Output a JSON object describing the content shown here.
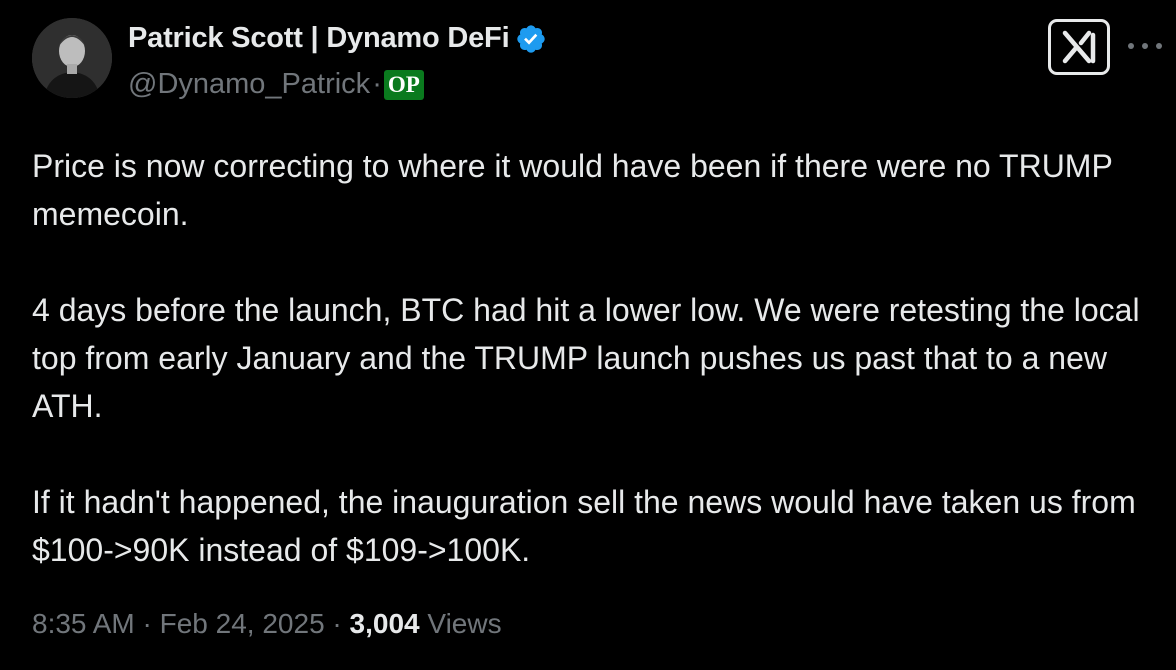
{
  "author": {
    "display_name": "Patrick Scott | Dynamo DeFi",
    "handle": "@Dynamo_Patrick",
    "separator": "·",
    "op_badge": "OP",
    "verified_color": "#1d9bf0",
    "icons": [
      "avatar",
      "verified-badge-icon",
      "grok-icon",
      "more-icon"
    ]
  },
  "tweet": {
    "paragraphs": [
      "Price is now correcting to where it would have been if there were no TRUMP memecoin.",
      "4 days before the launch, BTC had hit a lower low. We were retesting the local top from early January and the TRUMP launch pushes us past that to a new ATH.",
      "If it hadn't happened, the inauguration sell the news would have taken us from $100->90K instead of $109->100K."
    ]
  },
  "meta": {
    "time": "8:35 AM",
    "sep1": " · ",
    "date": "Feb 24, 2025",
    "sep2": " · ",
    "views_count": "3,004",
    "views_label": " Views"
  },
  "colors": {
    "background": "#000000",
    "text": "#e7e9ea",
    "muted": "#71767b",
    "op_badge_bg": "#0a7a1e"
  }
}
